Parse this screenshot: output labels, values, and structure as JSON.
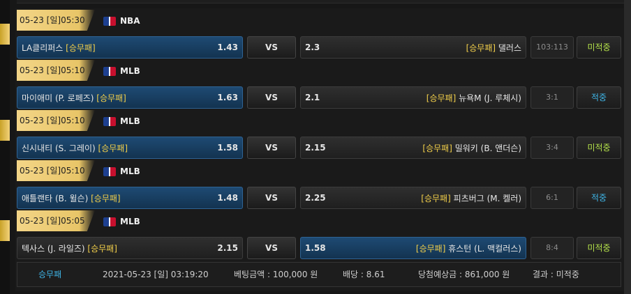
{
  "colors": {
    "gold_band": "#e8c567",
    "selected_blue": "#1e4a73",
    "tag_yellow": "#f2cf4a",
    "pending_green": "#b5e24a",
    "win_blue": "#3fb6e8"
  },
  "games": [
    {
      "datetime": "05-23 [일]05:30",
      "league": "NBA",
      "league_icon": "nba-logo-icon",
      "home_name": "LA클리퍼스",
      "home_odds": "1.43",
      "vs": "VS",
      "away_odds": "2.3",
      "away_name": "댈러스",
      "tag": "[승무패]",
      "score": "103:113",
      "status": "미적중",
      "selected": "home"
    },
    {
      "datetime": "05-23 [일]05:10",
      "league": "MLB",
      "league_icon": "mlb-logo-icon",
      "home_name": "마이애미 (P. 로페즈)",
      "home_odds": "1.63",
      "vs": "VS",
      "away_odds": "2.1",
      "away_name": "뉴욕M (J. 루체시)",
      "tag": "[승무패]",
      "score": "3:1",
      "status": "적중",
      "selected": "home"
    },
    {
      "datetime": "05-23 [일]05:10",
      "league": "MLB",
      "league_icon": "mlb-logo-icon",
      "home_name": "신시내티 (S. 그레이)",
      "home_odds": "1.58",
      "vs": "VS",
      "away_odds": "2.15",
      "away_name": "밀워키 (B. 앤더슨)",
      "tag": "[승무패]",
      "score": "3:4",
      "status": "미적중",
      "selected": "home"
    },
    {
      "datetime": "05-23 [일]05:10",
      "league": "MLB",
      "league_icon": "mlb-logo-icon",
      "home_name": "애틀랜타 (B. 윌슨)",
      "home_odds": "1.48",
      "vs": "VS",
      "away_odds": "2.25",
      "away_name": "피츠버그 (M. 켈러)",
      "tag": "[승무패]",
      "score": "6:1",
      "status": "적중",
      "selected": "home"
    },
    {
      "datetime": "05-23 [일]05:05",
      "league": "MLB",
      "league_icon": "mlb-logo-icon",
      "home_name": "텍사스 (J. 라일즈)",
      "home_odds": "2.15",
      "vs": "VS",
      "away_odds": "1.58",
      "away_name": "휴스턴 (L. 맥컬러스)",
      "tag": "[승무패]",
      "score": "8:4",
      "status": "미적중",
      "selected": "away"
    }
  ],
  "summary": {
    "bet_type": "승무패",
    "datetime": "2021-05-23 [일] 03:19:20",
    "bet_amount": "베팅금액 : 100,000 원",
    "odds": "배당 : 8.61",
    "expected_win": "당첨예상금 : 861,000 원",
    "result": "결과 : 미적중"
  }
}
